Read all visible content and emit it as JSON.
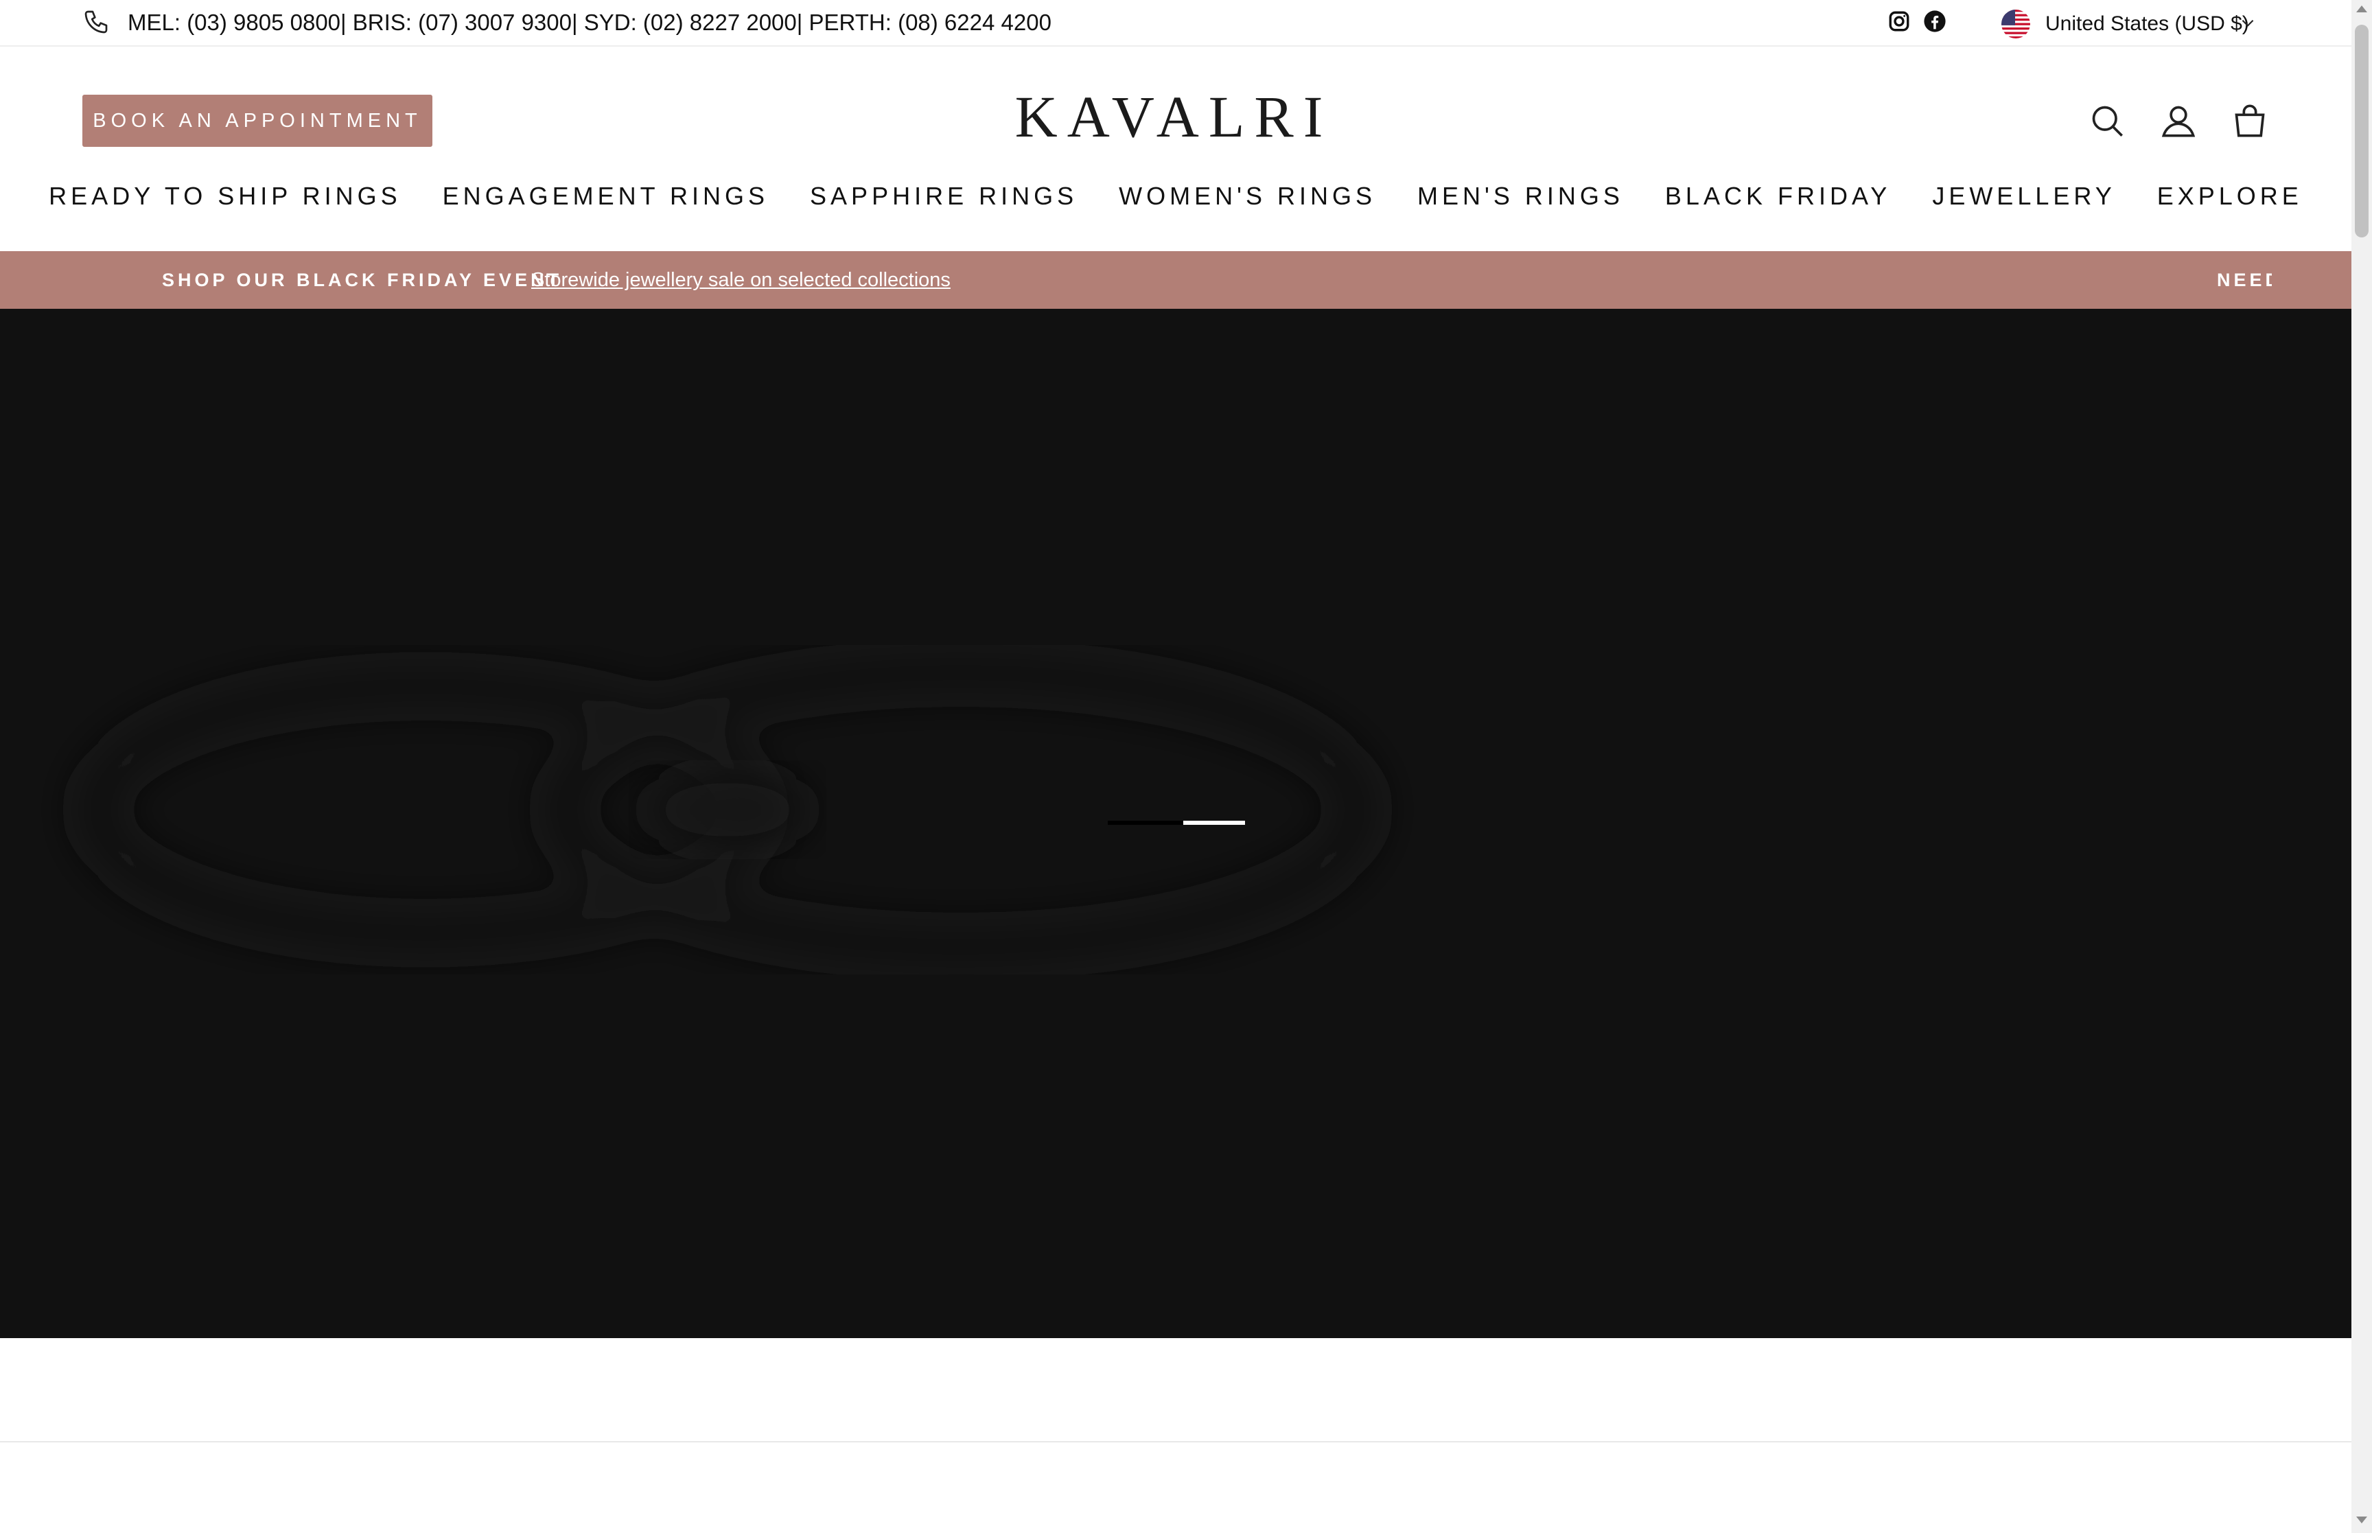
{
  "topbar": {
    "phone_text": "MEL: (03) 9805 0800| BRIS: (07) 3007 9300| SYD: (02) 8227 2000| PERTH: (08) 6224 4200",
    "currency": "United States (USD $)",
    "icons": [
      "phone-icon",
      "instagram-icon",
      "facebook-icon",
      "us-flag-icon",
      "chevron-down-icon"
    ]
  },
  "header": {
    "book_label": "BOOK AN APPOINTMENT",
    "logo": "KAVALRI",
    "icons": [
      "search-icon",
      "account-icon",
      "cart-icon"
    ]
  },
  "nav": {
    "items": [
      {
        "label": "READY TO SHIP RINGS"
      },
      {
        "label": "ENGAGEMENT RINGS"
      },
      {
        "label": "SAPPHIRE RINGS"
      },
      {
        "label": "WOMEN'S RINGS"
      },
      {
        "label": "MEN'S RINGS"
      },
      {
        "label": "BLACK FRIDAY"
      },
      {
        "label": "JEWELLERY"
      },
      {
        "label": "EXPLORE"
      }
    ]
  },
  "promo": {
    "headline": "SHOP OUR BLACK FRIDAY EVENT",
    "link": "Storewide jewellery sale on selected collections",
    "right_text": "NEED"
  },
  "hero": {
    "slide_progress": 0.55
  },
  "colors": {
    "accent": "#b27f76",
    "hero_bg": "#111111",
    "text": "#111111"
  }
}
